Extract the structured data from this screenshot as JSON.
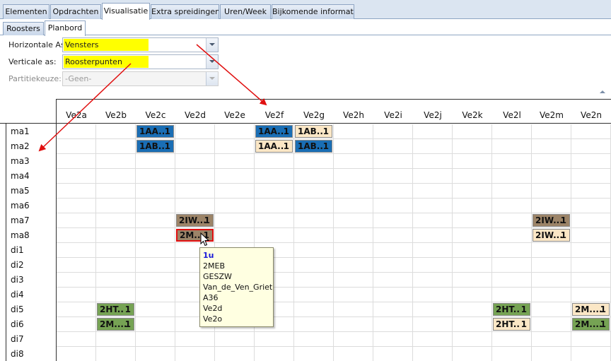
{
  "tabs": [
    {
      "label": "Elementen",
      "active": false
    },
    {
      "label": "Opdrachten",
      "active": false
    },
    {
      "label": "Visualisatie",
      "active": true
    },
    {
      "label": "Extra spreidingen",
      "active": false
    },
    {
      "label": "Uren/Week",
      "active": false
    },
    {
      "label": "Bijkomende informatie",
      "active": false
    }
  ],
  "subtabs": [
    {
      "label": "Roosters",
      "active": false
    },
    {
      "label": "Planbord",
      "active": true
    }
  ],
  "form": {
    "horizontal": {
      "label": "Horizontale As:",
      "value": "Vensters"
    },
    "vertical": {
      "label": "Verticale as:",
      "value": "Roosterpunten"
    },
    "partition": {
      "label": "Partitiekeuze:",
      "value": "-Geen-"
    }
  },
  "grid": {
    "columns": [
      "Ve2a",
      "Ve2b",
      "Ve2c",
      "Ve2d",
      "Ve2e",
      "Ve2f",
      "Ve2g",
      "Ve2h",
      "Ve2i",
      "Ve2j",
      "Ve2k",
      "Ve2l",
      "Ve2m",
      "Ve2n"
    ],
    "rows": [
      "ma1",
      "ma2",
      "ma3",
      "ma4",
      "ma5",
      "ma6",
      "ma7",
      "ma8",
      "di1",
      "di2",
      "di3",
      "di4",
      "di5",
      "di6",
      "di7",
      "di8"
    ],
    "chips": [
      {
        "text": "1AA..",
        "num": "1",
        "color": "blue",
        "row": 0,
        "col": 2
      },
      {
        "text": "1AA..",
        "num": "1",
        "color": "blue",
        "row": 0,
        "col": 5
      },
      {
        "text": "1AB..",
        "num": "1",
        "color": "cream",
        "row": 0,
        "col": 6
      },
      {
        "text": "1AB..",
        "num": "1",
        "color": "blue",
        "row": 1,
        "col": 2
      },
      {
        "text": "1AA..",
        "num": "1",
        "color": "cream",
        "row": 1,
        "col": 5
      },
      {
        "text": "1AB..",
        "num": "1",
        "color": "blue",
        "row": 1,
        "col": 6
      },
      {
        "text": "2IW...",
        "num": "1",
        "color": "brown",
        "row": 6,
        "col": 3
      },
      {
        "text": "2IW...",
        "num": "1",
        "color": "brown",
        "row": 6,
        "col": 12
      },
      {
        "text": "2M....",
        "num": "1",
        "color": "brown",
        "row": 7,
        "col": 3,
        "selected": true
      },
      {
        "text": "2IW...",
        "num": "1",
        "color": "cream",
        "row": 7,
        "col": 12
      },
      {
        "text": "2HT..",
        "num": "1",
        "color": "green",
        "row": 12,
        "col": 1
      },
      {
        "text": "2HT..",
        "num": "1",
        "color": "green",
        "row": 12,
        "col": 11
      },
      {
        "text": "2M....",
        "num": "1",
        "color": "cream",
        "row": 12,
        "col": 13
      },
      {
        "text": "2M....",
        "num": "1",
        "color": "green",
        "row": 13,
        "col": 1
      },
      {
        "text": "2HT..",
        "num": "1",
        "color": "cream",
        "row": 13,
        "col": 11
      },
      {
        "text": "2M....",
        "num": "1",
        "color": "green",
        "row": 13,
        "col": 13
      }
    ]
  },
  "tooltip": {
    "lines": [
      "1u",
      "2MEB",
      "GESZW",
      "Van_de_Ven_Griet",
      "A36",
      "Ve2d",
      "Ve2o"
    ]
  },
  "colors": {
    "highlight": "#ffff00",
    "chip_blue": "#1a6eb5",
    "chip_cream": "#fbe7c6",
    "chip_brown": "#9c8468",
    "chip_green": "#76a354",
    "selection": "#e01010",
    "arrow": "#e01010",
    "tooltip_bg": "#ffffe1"
  }
}
